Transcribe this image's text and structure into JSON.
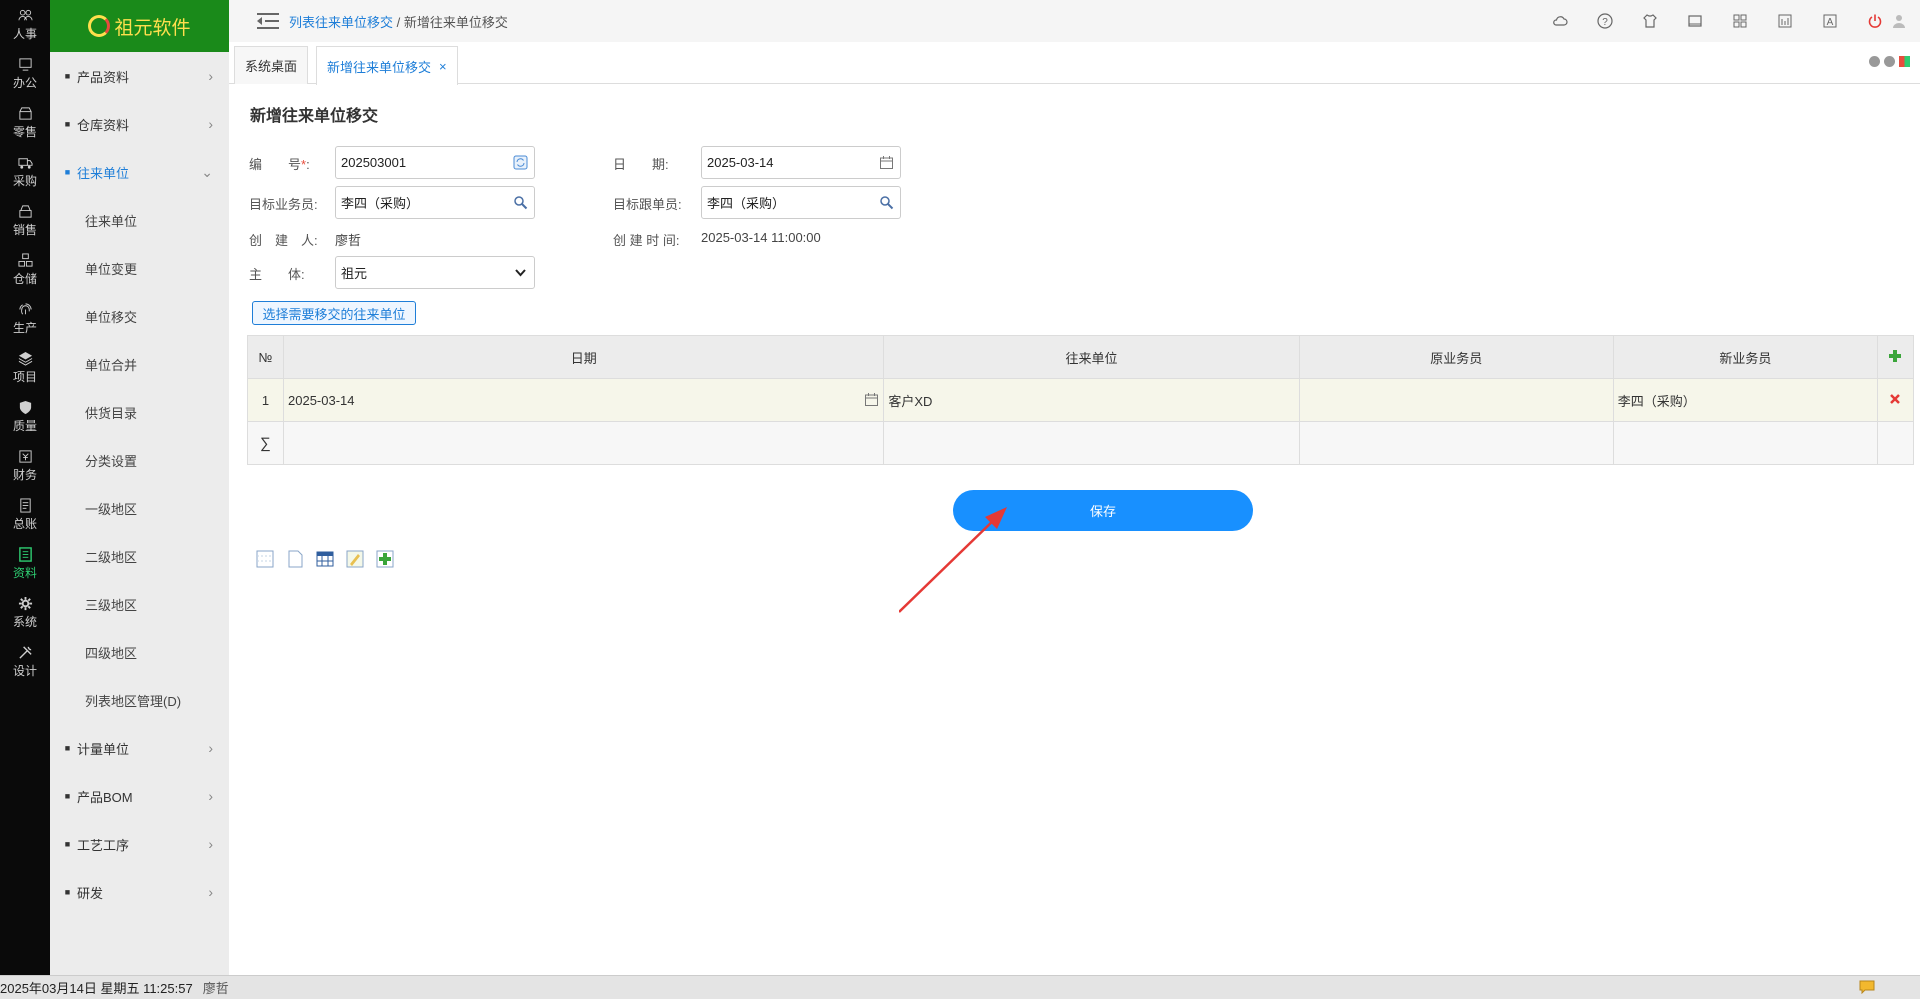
{
  "rail": [
    {
      "label": "人事",
      "icon": "people-icon"
    },
    {
      "label": "办公",
      "icon": "monitor-icon"
    },
    {
      "label": "零售",
      "icon": "store-icon"
    },
    {
      "label": "采购",
      "icon": "truck-icon"
    },
    {
      "label": "销售",
      "icon": "shop-icon"
    },
    {
      "label": "仓储",
      "icon": "boxes-icon"
    },
    {
      "label": "生产",
      "icon": "fingerprint-icon"
    },
    {
      "label": "项目",
      "icon": "layers-icon"
    },
    {
      "label": "质量",
      "icon": "shield-icon"
    },
    {
      "label": "财务",
      "icon": "finance-icon"
    },
    {
      "label": "总账",
      "icon": "ledger-icon"
    },
    {
      "label": "资料",
      "icon": "document-icon"
    },
    {
      "label": "系统",
      "icon": "gear-icon"
    },
    {
      "label": "设计",
      "icon": "tools-icon"
    }
  ],
  "logo": {
    "text": "祖元软件"
  },
  "subnav": {
    "groups_before": [
      {
        "label": "产品资料"
      },
      {
        "label": "仓库资料"
      }
    ],
    "open_group": {
      "label": "往来单位"
    },
    "open_items": [
      "往来单位",
      "单位变更",
      "单位移交",
      "单位合并",
      "供货目录",
      "分类设置",
      "一级地区",
      "二级地区",
      "三级地区",
      "四级地区",
      "列表地区管理(D)"
    ],
    "groups_after": [
      {
        "label": "计量单位"
      },
      {
        "label": "产品BOM"
      },
      {
        "label": "工艺工序"
      },
      {
        "label": "研发"
      }
    ]
  },
  "breadcrumb": {
    "link": "列表往来单位移交",
    "sep": " / ",
    "current": "新增往来单位移交"
  },
  "tabs": {
    "home": "系统桌面",
    "active": "新增往来单位移交",
    "close": "×"
  },
  "form": {
    "title": "新增往来单位移交",
    "code_label": "编　　号",
    "code_required": "*",
    "code_colon": ":",
    "code_value": "202503001",
    "date_label": "日　　期:",
    "date_value": "2025-03-14",
    "target_sales_label": "目标业务员:",
    "target_sales_value": "李四（采购）",
    "target_follow_label": "目标跟单员:",
    "target_follow_value": "李四（采购）",
    "creator_label": "创　建　人:",
    "creator_value": "廖哲",
    "created_time_label": "创 建 时 间:",
    "created_time_value": "2025-03-14 11:00:00",
    "entity_label": "主　　体:",
    "entity_value": "祖元",
    "select_button": "选择需要移交的往来单位"
  },
  "grid": {
    "headers": [
      "№",
      "日期",
      "往来单位",
      "原业务员",
      "新业务员"
    ],
    "rows": [
      {
        "no": "1",
        "date": "2025-03-14",
        "unit": "客户XD",
        "old": "",
        "new": "李四（采购）"
      }
    ],
    "sum_symbol": "∑"
  },
  "save_button": "保存",
  "status": {
    "datetime": "2025年03月14日 星期五 11:25:57",
    "user": "廖哲"
  },
  "colors": {
    "accent": "#1890ff",
    "brand_green": "#1a8a1a",
    "rail_bg": "#0a0a0a",
    "annotation_arrow": "#e53935"
  }
}
